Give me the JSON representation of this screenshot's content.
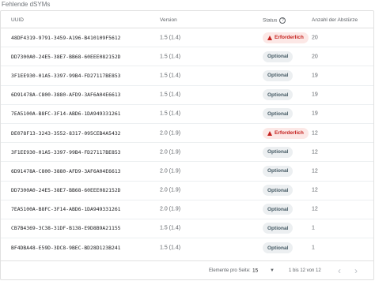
{
  "title": "Fehlende dSYMs",
  "columns": {
    "uuid": "UUID",
    "version": "Version",
    "status": "Status",
    "count": "Anzahl der Abstürze"
  },
  "status_help_icon": "help-circle-icon",
  "status_labels": {
    "required": "Erforderlich",
    "optional": "Optional"
  },
  "rows": [
    {
      "uuid": "48DF4319-9791-3459-A196-B410109F5612",
      "version": "1.5 (1.4)",
      "status": "Erforderlich",
      "status_type": "required",
      "count": "20"
    },
    {
      "uuid": "DD7300A0-24E5-38E7-BB68-60EEE082152D",
      "version": "1.5 (1.4)",
      "status": "Optional",
      "status_type": "optional",
      "count": "20"
    },
    {
      "uuid": "3F1EE930-01A5-3397-99B4-FD27117BE853",
      "version": "1.5 (1.4)",
      "status": "Optional",
      "status_type": "optional",
      "count": "19"
    },
    {
      "uuid": "6D91478A-C800-3880-AFD9-3AF6A04E6613",
      "version": "1.5 (1.4)",
      "status": "Optional",
      "status_type": "optional",
      "count": "19"
    },
    {
      "uuid": "7EA5100A-B8FC-3F14-ABD6-1DA949331261",
      "version": "1.5 (1.4)",
      "status": "Optional",
      "status_type": "optional",
      "count": "19"
    },
    {
      "uuid": "DE078F13-3243-3552-8317-095CEB4A5432",
      "version": "2.0 (1.9)",
      "status": "Erforderlich",
      "status_type": "required",
      "count": "12"
    },
    {
      "uuid": "3F1EE930-01A5-3397-99B4-FD27117BE853",
      "version": "2.0 (1.9)",
      "status": "Optional",
      "status_type": "optional",
      "count": "12"
    },
    {
      "uuid": "6D91478A-C800-3880-AFD9-3AF6A04E6613",
      "version": "2.0 (1.9)",
      "status": "Optional",
      "status_type": "optional",
      "count": "12"
    },
    {
      "uuid": "DD7300A0-24E5-38E7-BB68-60EEE082152D",
      "version": "2.0 (1.9)",
      "status": "Optional",
      "status_type": "optional",
      "count": "12"
    },
    {
      "uuid": "7EA5100A-B8FC-3F14-ABD6-1DA949331261",
      "version": "2.0 (1.9)",
      "status": "Optional",
      "status_type": "optional",
      "count": "12"
    },
    {
      "uuid": "CB7B4369-3C38-31DF-B138-E9D8B9A21155",
      "version": "1.5 (1.4)",
      "status": "Optional",
      "status_type": "optional",
      "count": "1"
    },
    {
      "uuid": "BF4DBA48-E59D-3DC8-9BEC-BD28D123B241",
      "version": "1.5 (1.4)",
      "status": "Optional",
      "status_type": "optional",
      "count": "1"
    }
  ],
  "footer": {
    "per_page_label": "Elemente pro Seite:",
    "per_page_value": "15",
    "range": "1 bis 12 von 12",
    "prev_icon": "chevron-left-icon",
    "next_icon": "chevron-right-icon"
  },
  "colors": {
    "required_text": "#c5221f",
    "required_bg": "#fce8e6",
    "optional_text": "#455a64",
    "optional_bg": "#eceff1"
  }
}
